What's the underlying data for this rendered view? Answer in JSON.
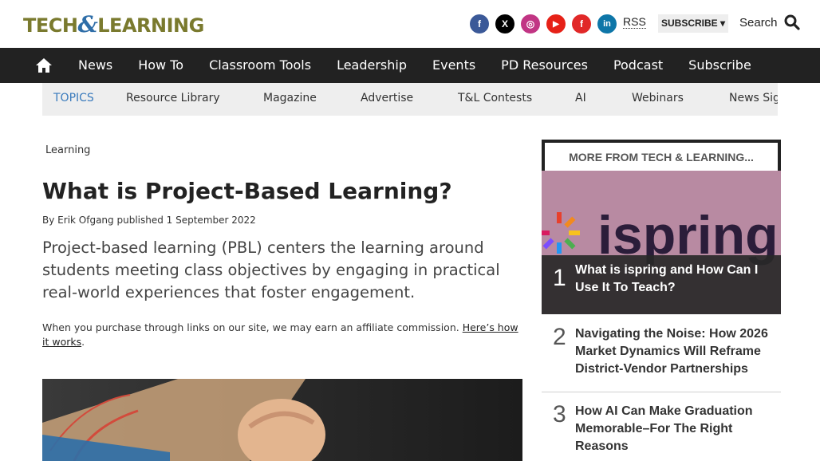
{
  "header": {
    "logo_left": "TECH",
    "logo_amp": "&",
    "logo_right": "LEARNING",
    "rss_label": "RSS",
    "subscribe_label": "SUBSCRIBE",
    "search_label": "Search"
  },
  "social": [
    {
      "name": "facebook-icon",
      "glyph": "f",
      "color": "#3b5998"
    },
    {
      "name": "x-icon",
      "glyph": "X",
      "color": "#000000"
    },
    {
      "name": "instagram-icon",
      "glyph": "◎",
      "color": "#c13584"
    },
    {
      "name": "youtube-icon",
      "glyph": "▶",
      "color": "#e62117"
    },
    {
      "name": "flipboard-icon",
      "glyph": "f",
      "color": "#e12828"
    },
    {
      "name": "linkedin-icon",
      "glyph": "in",
      "color": "#0e76a8"
    }
  ],
  "nav": {
    "items": [
      "News",
      "How To",
      "Classroom Tools",
      "Leadership",
      "Events",
      "PD Resources",
      "Podcast",
      "Subscribe"
    ]
  },
  "topics": {
    "label": "TOPICS",
    "items": [
      "Resource Library",
      "Magazine",
      "Advertise",
      "T&L Contests",
      "AI",
      "Webinars",
      "News Sig"
    ]
  },
  "article": {
    "breadcrumb": "Learning",
    "title": "What is Project-Based Learning?",
    "byline_prefix": "By",
    "author": "Erik Ofgang",
    "published": "published 1 September 2022",
    "standfirst": "Project-based learning (PBL) centers the learning around students meeting class objectives by engaging in practical real-world experiences that foster engagement.",
    "affiliate_text": "When you purchase through links on our site, we may earn an affiliate commission.",
    "affiliate_link": "Here’s how it works",
    "affiliate_end": "."
  },
  "sidebar": {
    "heading": "MORE FROM TECH & LEARNING...",
    "feature_brand": "ispring",
    "items": [
      {
        "number": "1",
        "title": "What is ispring and How Can I Use It To Teach?"
      },
      {
        "number": "2",
        "title": "Navigating the Noise: How 2026 Market Dynamics Will Reframe District-Vendor Partnerships"
      },
      {
        "number": "3",
        "title": "How AI Can Make Graduation Memorable–For The Right Reasons"
      }
    ]
  },
  "colors": {
    "nav_bg": "#222222",
    "topics_accent": "#3a7bbd",
    "logo_olive": "#7a7a2e",
    "logo_blue": "#2f6ea8"
  }
}
